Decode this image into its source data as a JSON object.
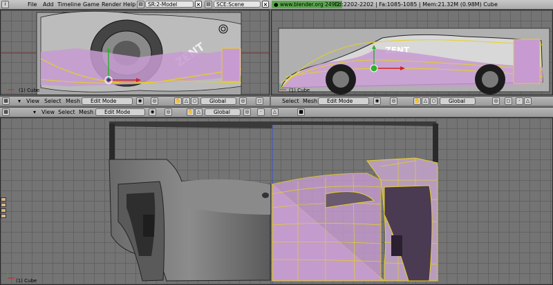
{
  "menu": {
    "items": [
      "File",
      "Add",
      "Timeline",
      "Game",
      "Render",
      "Help"
    ],
    "screen_field": "SR:2-Model",
    "scene_field": "SCE:Scene",
    "url": "www.blender.org 249.2",
    "stats": "Ed:2202-2202 | Fa:1085-1085 | Mem:21.32M (0.98M) Cube"
  },
  "viewports": {
    "top_left": {
      "label": "(1) Cube"
    },
    "top_right": {
      "label": "(1) Cube"
    },
    "bottom": {
      "label": "(1) Cube"
    }
  },
  "headers": {
    "left": {
      "view": "View",
      "select": "Select",
      "mesh": "Mesh",
      "mode": "Edit Mode",
      "orientation": "Global"
    },
    "right": {
      "select": "Select",
      "mesh": "Mesh",
      "mode": "Edit Mode",
      "orientation": "Global"
    },
    "bottom": {
      "view": "View",
      "select": "Select",
      "mesh": "Mesh",
      "mode": "Edit Mode",
      "orientation": "Global"
    }
  },
  "colors": {
    "accent_green": "#58a84a",
    "wire": "#e6d21e",
    "face_select": "#c79bd1",
    "grid": "#747474"
  }
}
